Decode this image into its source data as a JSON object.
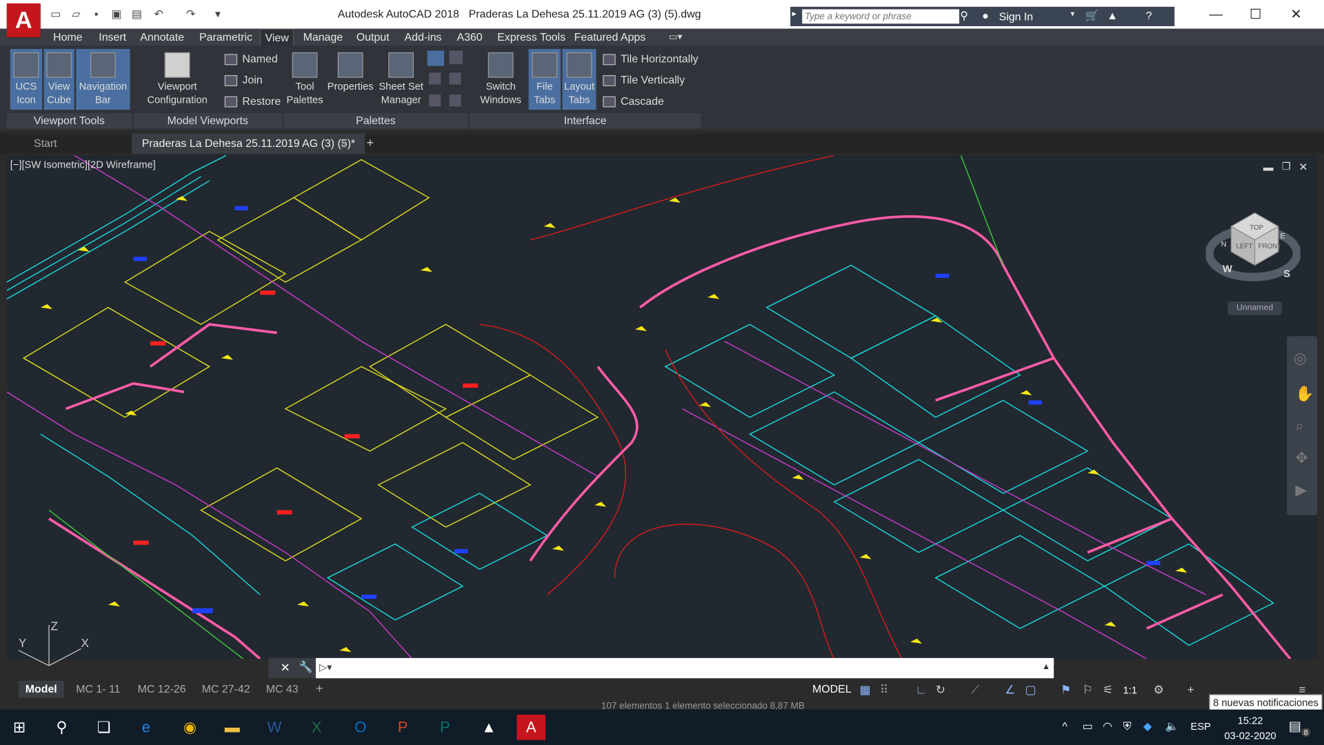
{
  "window": {
    "app_title": "Autodesk AutoCAD 2018",
    "file_title": "Praderas La Dehesa 25.11.2019 AG (3) (5).dwg",
    "logo_letter": "A",
    "controls": {
      "minimize": "—",
      "maximize": "☐",
      "close": "✕"
    }
  },
  "header": {
    "search_placeholder": "Type a keyword or phrase",
    "sign_in": "Sign In"
  },
  "menu_tabs": [
    "Home",
    "Insert",
    "Annotate",
    "Parametric",
    "View",
    "Manage",
    "Output",
    "Add-ins",
    "A360",
    "Express Tools",
    "Featured Apps"
  ],
  "active_menu_tab": "View",
  "ribbon": {
    "viewport_tools": {
      "title": "Viewport Tools",
      "buttons": [
        "UCS\nIcon",
        "View\nCube",
        "Navigation\nBar"
      ]
    },
    "model_viewports": {
      "title": "Model Viewports",
      "big": "Viewport\nConfiguration",
      "small": [
        "Named",
        "Join",
        "Restore"
      ]
    },
    "palettes": {
      "title": "Palettes",
      "buttons": [
        "Tool\nPalettes",
        "Properties",
        "Sheet Set\nManager"
      ]
    },
    "interface": {
      "title": "Interface",
      "buttons": [
        "Switch\nWindows",
        "File\nTabs",
        "Layout\nTabs"
      ],
      "small": [
        "Tile Horizontally",
        "Tile Vertically",
        "Cascade"
      ]
    }
  },
  "file_tabs": {
    "start": "Start",
    "drawing": "Praderas La Dehesa 25.11.2019 AG (3) (5)*",
    "add": "+"
  },
  "viewport": {
    "label": "[−][SW Isometric][2D Wireframe]",
    "viewcube_faces": {
      "top": "TOP",
      "left": "LEFT",
      "front": "FRONT"
    },
    "compass": {
      "n": "N",
      "w": "W",
      "s": "S",
      "e": "E"
    },
    "view_name": "Unnamed",
    "ucs": {
      "x": "X",
      "y": "Y",
      "z": "Z"
    }
  },
  "layout_tabs": [
    "Model",
    "MC 1- 11",
    "MC 12-26",
    "MC 27-42",
    "MC 43"
  ],
  "status": {
    "model": "MODEL",
    "scale": "1:1",
    "hint": "107 elementos     1 elemento seleccionado  8,87 MB",
    "notification": "8 nuevas notificaciones"
  },
  "taskbar": {
    "lang": "ESP",
    "time": "15:22",
    "date": "03-02-2020",
    "notif_count": "8"
  },
  "colors": {
    "bg": "#212830",
    "accent": "#4a6fa0",
    "autocad_red": "#c4161c"
  }
}
